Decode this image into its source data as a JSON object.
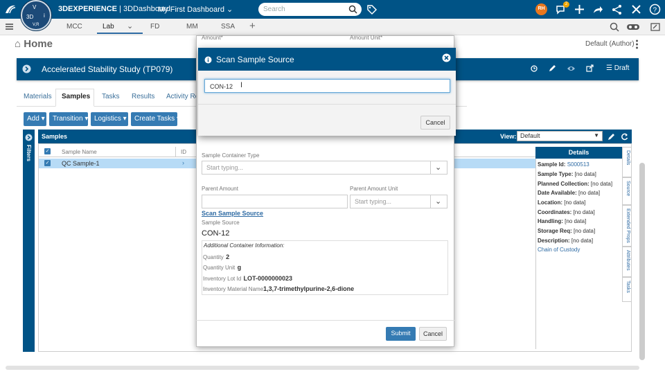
{
  "app": {
    "brand_bold": "3DEXPERIENCE",
    "brand_rest": " | 3DDashboard",
    "dashboard": "My First Dashboard",
    "compass": {
      "label_3d": "3D",
      "label_v": "V",
      "label_vr": "V,R",
      "label_i": "i"
    }
  },
  "search": {
    "placeholder": "Search"
  },
  "user_badge": {
    "initials": "RH"
  },
  "notifications": {
    "count": "2"
  },
  "tabs": [
    "MCC",
    "Lab",
    "FD",
    "MM",
    "SSA"
  ],
  "page": {
    "title": "Home",
    "author": "Default (Author)"
  },
  "study": {
    "title": "Accelerated Stability Study (TP079)",
    "status": "Draft"
  },
  "main_tabs": [
    "Materials",
    "Samples",
    "Tasks",
    "Results",
    "Activity Re"
  ],
  "toolbar": {
    "add": "Add",
    "transition": "Transition",
    "logistics": "Logistics",
    "create_tasks": "Create Tasks"
  },
  "grid": {
    "title": "Samples",
    "filters": "Filters",
    "view_label": "View:",
    "view_value": "Default",
    "col_name": "Sample Name",
    "col_id": "ID",
    "rows": [
      {
        "name": "QC Sample-1"
      }
    ]
  },
  "details": {
    "title": "Details",
    "sample_id_label": "Sample Id:",
    "sample_id": "S000513",
    "sample_type": "Sample Type:",
    "planned": "Planned Collection:",
    "date_avail": "Date Available:",
    "location": "Location:",
    "coordinates": "Coordinates:",
    "handling": "Handling:",
    "storage": "Storage Req:",
    "description": "Description:",
    "no_data": "[no data]",
    "chain": "Chain of Custody"
  },
  "side_tabs": [
    "Details",
    "Source",
    "Extended Props",
    "Attributes",
    "Tasks"
  ],
  "form": {
    "amount_label": "Amount*",
    "amount_unit_label": "Amount Unit*",
    "container_type_label": "Sample Container Type",
    "typing": "Start typing...",
    "parent_amount_label": "Parent Amount",
    "parent_amount_unit_label": "Parent Amount Unit",
    "scan_link": "Scan Sample Source",
    "sample_source_label": "Sample Source",
    "sample_source_value": "CON-12",
    "info_title": "Additional Container Information:",
    "quantity_label": "Quantity",
    "quantity_value": "2",
    "quantity_unit_label": "Quantity Unit",
    "quantity_unit_value": "g",
    "lot_label": "Inventory Lot Id",
    "lot_value": "LOT-0000000023",
    "material_label": "Inventory Material Name",
    "material_value": "1,3,7-trimethylpurine-2,6-dione",
    "submit": "Submit",
    "cancel": "Cancel"
  },
  "modal": {
    "title": "Scan Sample Source",
    "input_value": "CON-12",
    "cancel": "Cancel"
  },
  "colors": {
    "primary": "#005386",
    "button": "#357bb3",
    "link": "#2d6aa3",
    "selected_row": "#b7dbf6",
    "user_badge": "#e8771e",
    "notif_badge": "#f0a500"
  }
}
